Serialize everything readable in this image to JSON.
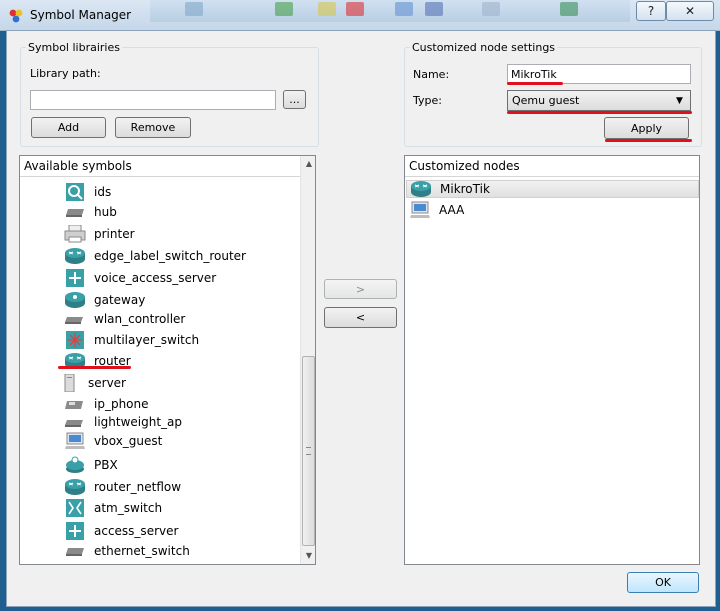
{
  "window": {
    "title": "Symbol Manager",
    "help_label": "?",
    "close_label": "✕"
  },
  "libraries": {
    "group_label": "Symbol librairies",
    "path_label": "Library path:",
    "path_value": "",
    "browse_label": "...",
    "add_label": "Add",
    "remove_label": "Remove"
  },
  "settings": {
    "group_label": "Customized node settings",
    "name_label": "Name:",
    "name_value": "MikroTik",
    "type_label": "Type:",
    "type_value": "Qemu guest",
    "apply_label": "Apply"
  },
  "available": {
    "header": "Available symbols",
    "items": [
      {
        "label": "ids",
        "icon": "ids-icon"
      },
      {
        "label": "hub",
        "icon": "hub-icon"
      },
      {
        "label": "printer",
        "icon": "printer-icon"
      },
      {
        "label": "edge_label_switch_router",
        "icon": "router-icon"
      },
      {
        "label": "voice_access_server",
        "icon": "voice-access-server-icon"
      },
      {
        "label": "gateway",
        "icon": "gateway-icon"
      },
      {
        "label": "wlan_controller",
        "icon": "wlan-controller-icon"
      },
      {
        "label": "multilayer_switch",
        "icon": "multilayer-switch-icon"
      },
      {
        "label": "router",
        "icon": "router-icon"
      },
      {
        "label": "server",
        "icon": "server-icon"
      },
      {
        "label": "ip_phone",
        "icon": "ip-phone-icon"
      },
      {
        "label": "lightweight_ap",
        "icon": "access-point-icon"
      },
      {
        "label": "vbox_guest",
        "icon": "computer-icon"
      },
      {
        "label": "PBX",
        "icon": "pbx-icon"
      },
      {
        "label": "router_netflow",
        "icon": "router-icon"
      },
      {
        "label": "atm_switch",
        "icon": "atm-switch-icon"
      },
      {
        "label": "access_server",
        "icon": "access-server-icon"
      },
      {
        "label": "ethernet_switch",
        "icon": "ethernet-switch-icon"
      }
    ]
  },
  "move": {
    "right_label": ">",
    "left_label": "<"
  },
  "customized": {
    "header": "Customized nodes",
    "items": [
      {
        "label": "MikroTik",
        "icon": "router-icon",
        "selected": true
      },
      {
        "label": "AAA",
        "icon": "computer-icon",
        "selected": false
      }
    ]
  },
  "footer": {
    "ok_label": "OK"
  },
  "colors": {
    "annotation_red": "#e0101e",
    "teal": "#3aa0a8",
    "accent_blue": "#3c7fb1"
  }
}
